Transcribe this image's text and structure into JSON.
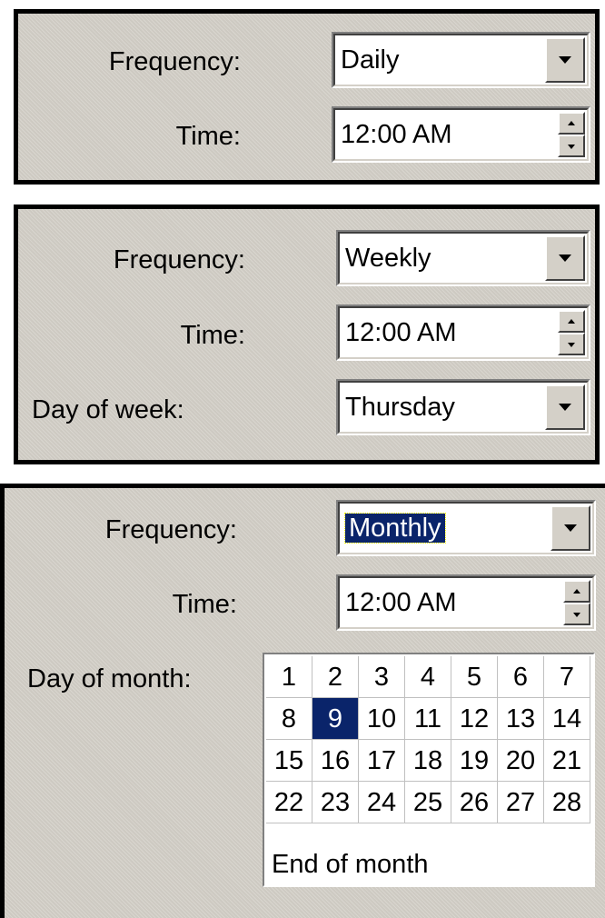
{
  "daily": {
    "frequency_label": "Frequency:",
    "frequency_value": "Daily",
    "time_label": "Time:",
    "time_value": "12:00 AM"
  },
  "weekly": {
    "frequency_label": "Frequency:",
    "frequency_value": "Weekly",
    "time_label": "Time:",
    "time_value": "12:00 AM",
    "day_label": "Day of week:",
    "day_value": "Thursday"
  },
  "monthly": {
    "frequency_label": "Frequency:",
    "frequency_value": "Monthly",
    "time_label": "Time:",
    "time_value": "12:00 AM",
    "day_label": "Day of month:",
    "days": [
      "1",
      "2",
      "3",
      "4",
      "5",
      "6",
      "7",
      "8",
      "9",
      "10",
      "11",
      "12",
      "13",
      "14",
      "15",
      "16",
      "17",
      "18",
      "19",
      "20",
      "21",
      "22",
      "23",
      "24",
      "25",
      "26",
      "27",
      "28"
    ],
    "selected_day": "9",
    "end_of_month": "End of month"
  },
  "colors": {
    "selection": "#0a246a",
    "panel": "#d4d0c8"
  }
}
